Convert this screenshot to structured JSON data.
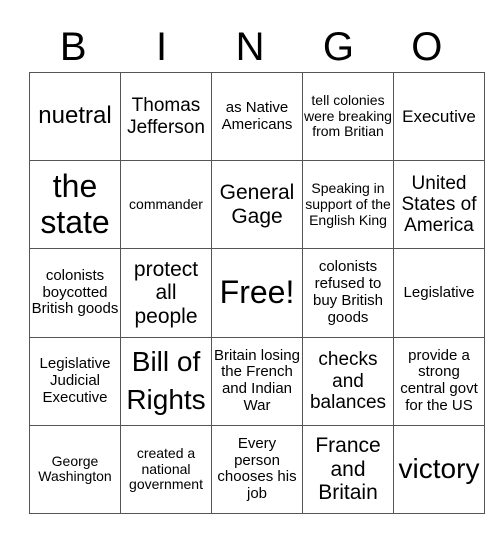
{
  "header": [
    "B",
    "I",
    "N",
    "G",
    "O"
  ],
  "grid": [
    [
      "nuetral",
      "Thomas Jefferson",
      "as Native Americans",
      "tell colonies were breaking from Britian",
      "Executive"
    ],
    [
      "the state",
      "commander",
      "General Gage",
      "Speaking in support of the English King",
      "United States of America"
    ],
    [
      "colonists boycotted British goods",
      "protect all people",
      "Free!",
      "colonists refused to buy British goods",
      "Legislative"
    ],
    [
      "Legislative Judicial Executive",
      "Bill of Rights",
      "Britain losing the French and Indian War",
      "checks and balances",
      "provide a strong central govt for the US"
    ],
    [
      "George Washington",
      "created a national government",
      "Every person chooses his job",
      "France and Britain",
      "victory"
    ]
  ]
}
